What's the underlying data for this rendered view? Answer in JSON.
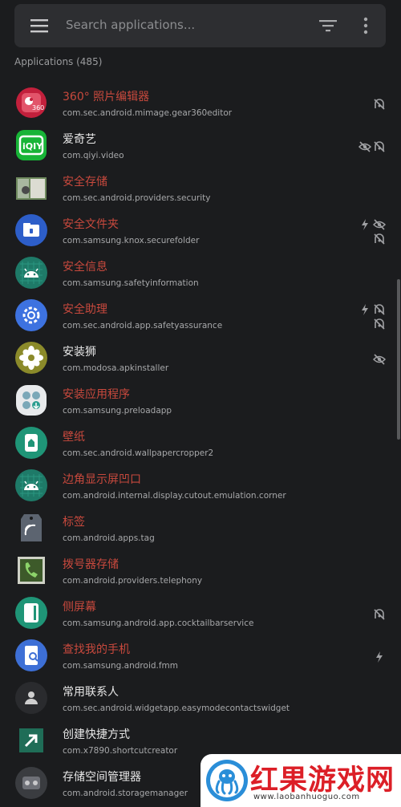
{
  "search": {
    "placeholder": "Search applications..."
  },
  "section_title": "Applications (485)",
  "apps": [
    {
      "name": "360° 照片编辑器",
      "package": "com.sec.android.mimage.gear360editor",
      "name_color": "red",
      "icon": "gear360-icon",
      "flags": [
        "tracker-off-icon"
      ]
    },
    {
      "name": "爱奇艺",
      "package": "com.qiyi.video",
      "name_color": "white",
      "icon": "iqiyi-icon",
      "flags": [
        "hidden-icon",
        "tracker-off-icon"
      ]
    },
    {
      "name": "安全存储",
      "package": "com.sec.android.providers.security",
      "name_color": "red",
      "icon": "security-storage-icon",
      "flags": []
    },
    {
      "name": "安全文件夹",
      "package": "com.samsung.knox.securefolder",
      "name_color": "red",
      "icon": "secure-folder-icon",
      "flags": [
        "bolt-icon",
        "hidden-icon",
        "tracker-off-icon"
      ]
    },
    {
      "name": "安全信息",
      "package": "com.samsung.safetyinformation",
      "name_color": "red",
      "icon": "android-icon",
      "flags": []
    },
    {
      "name": "安全助理",
      "package": "com.sec.android.app.safetyassurance",
      "name_color": "red",
      "icon": "gear-icon",
      "flags": [
        "bolt-icon",
        "tracker-off-icon",
        "tracker-off-icon"
      ]
    },
    {
      "name": "安装狮",
      "package": "com.modosa.apkinstaller",
      "name_color": "white",
      "icon": "flower-icon",
      "flags": [
        "hidden-icon"
      ]
    },
    {
      "name": "安装应用程序",
      "package": "com.samsung.preloadapp",
      "name_color": "red",
      "icon": "preload-icon",
      "flags": []
    },
    {
      "name": "壁纸",
      "package": "com.sec.android.wallpapercropper2",
      "name_color": "red",
      "icon": "wallpaper-icon",
      "flags": []
    },
    {
      "name": "边角显示屏凹口",
      "package": "com.android.internal.display.cutout.emulation.corner",
      "name_color": "red",
      "icon": "android-icon",
      "flags": []
    },
    {
      "name": "标签",
      "package": "com.android.apps.tag",
      "name_color": "red",
      "icon": "tag-icon",
      "flags": []
    },
    {
      "name": "拨号器存储",
      "package": "com.android.providers.telephony",
      "name_color": "red",
      "icon": "phone-icon",
      "flags": []
    },
    {
      "name": "侧屏幕",
      "package": "com.samsung.android.app.cocktailbarservice",
      "name_color": "red",
      "icon": "edge-screen-icon",
      "flags": [
        "tracker-off-icon"
      ]
    },
    {
      "name": "查找我的手机",
      "package": "com.samsung.android.fmm",
      "name_color": "red",
      "icon": "find-phone-icon",
      "flags": [
        "bolt-icon"
      ]
    },
    {
      "name": "常用联系人",
      "package": "com.sec.android.widgetapp.easymodecontactswidget",
      "name_color": "white",
      "icon": "contact-icon",
      "flags": []
    },
    {
      "name": "创建快捷方式",
      "package": "com.x7890.shortcutcreator",
      "name_color": "white",
      "icon": "shortcut-icon",
      "flags": []
    },
    {
      "name": "存储空间管理器",
      "package": "com.android.storagemanager",
      "name_color": "white",
      "icon": "storage-icon",
      "flags": []
    }
  ],
  "watermark": {
    "title": "红果游戏网",
    "url": "www.laobanhuoguo.com"
  },
  "colors": {
    "background": "#1b1c1e",
    "search_bg": "#2d2e31",
    "red_name": "#c8493d"
  }
}
